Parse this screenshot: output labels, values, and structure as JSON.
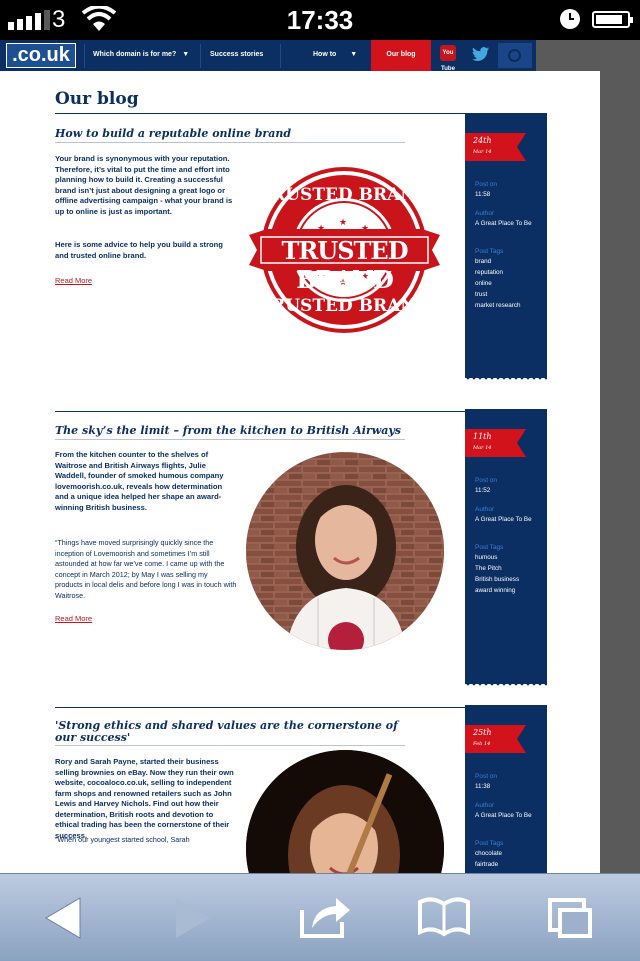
{
  "status_bar": {
    "carrier": "3",
    "time": "17:33"
  },
  "nav": {
    "logo": ".co.uk",
    "items": [
      "Which domain is for me?",
      "Success stories",
      "How to"
    ],
    "active": "Our blog",
    "youtube": "You Tube"
  },
  "page_title": "Our blog",
  "posts": [
    {
      "title": "How to build a reputable online brand",
      "excerpt_bold": "Your brand is synonymous with your reputation. Therefore, it’s vital to put the time and effort into planning how to build it. Creating a successful brand isn’t just about designing a great logo or offline advertising campaign - what your brand is up to online is just as important.",
      "excerpt_bold_2": "Here is some advice to help you build a strong and trusted online brand.",
      "read_more": "Read More",
      "image_text_top": "TRUSTED BRAND",
      "image_text_center": "TRUSTED BRAND",
      "image_text_bottom": "TRUSTED BRAND",
      "date_day": "24th",
      "date_month": "Mar 14",
      "post_on_label": "Post on",
      "post_on": "11:58",
      "author_label": "Author",
      "author": "A Great Place To Be",
      "tags_label": "Post Tags",
      "tags": [
        "brand",
        "reputation",
        "online",
        "trust",
        "market research"
      ]
    },
    {
      "title": "The sky’s the limit – from the kitchen to British Airways",
      "excerpt_bold": "From the kitchen counter to the shelves of Waitrose and British Airways flights, Julie Waddell, founder of smoked humous company lovemoorish.co.uk, reveals how determination and a unique idea helped her shape an award-winning British business.",
      "excerpt_plain": "“Things have moved surprisingly quickly since the inception of Lovemoorish and sometimes I’m still astounded at how far we’ve come. I came up with the concept in March 2012; by May I was selling my products in local delis and before long I was in touch with Waitrose.",
      "read_more": "Read More",
      "date_day": "11th",
      "date_month": "Mar 14",
      "post_on_label": "Post on",
      "post_on": "11:52",
      "author_label": "Author",
      "author": "A Great Place To Be",
      "tags_label": "Post Tags",
      "tags": [
        "humous",
        "The Pitch",
        "British business",
        "award winning"
      ]
    },
    {
      "title": "'Strong ethics and shared values are the cornerstone of our success'",
      "excerpt_bold": "Rory and Sarah Payne, started their business selling brownies on eBay. Now they run their own website, cocoaloco.co.uk, selling to independent farm shops and renowned retailers such as John Lewis and Harvey Nichols. Find out how their determination, British roots and devotion to ethical trading has been the cornerstone of their success.",
      "excerpt_plain": "“When our youngest started school, Sarah",
      "date_day": "25th",
      "date_month": "Feb 14",
      "post_on_label": "Post on",
      "post_on": "11:38",
      "author_label": "Author",
      "author": "A Great Place To Be",
      "tags_label": "Post Tags",
      "tags": [
        "chocolate",
        "fairtrade"
      ]
    }
  ],
  "colors": {
    "navy": "#0b2f63",
    "red": "#d3131b",
    "link_blue": "#3c7fd0"
  },
  "toolbar": {
    "icons": [
      "back-icon",
      "forward-icon",
      "share-icon",
      "bookmarks-icon",
      "tabs-icon"
    ]
  }
}
